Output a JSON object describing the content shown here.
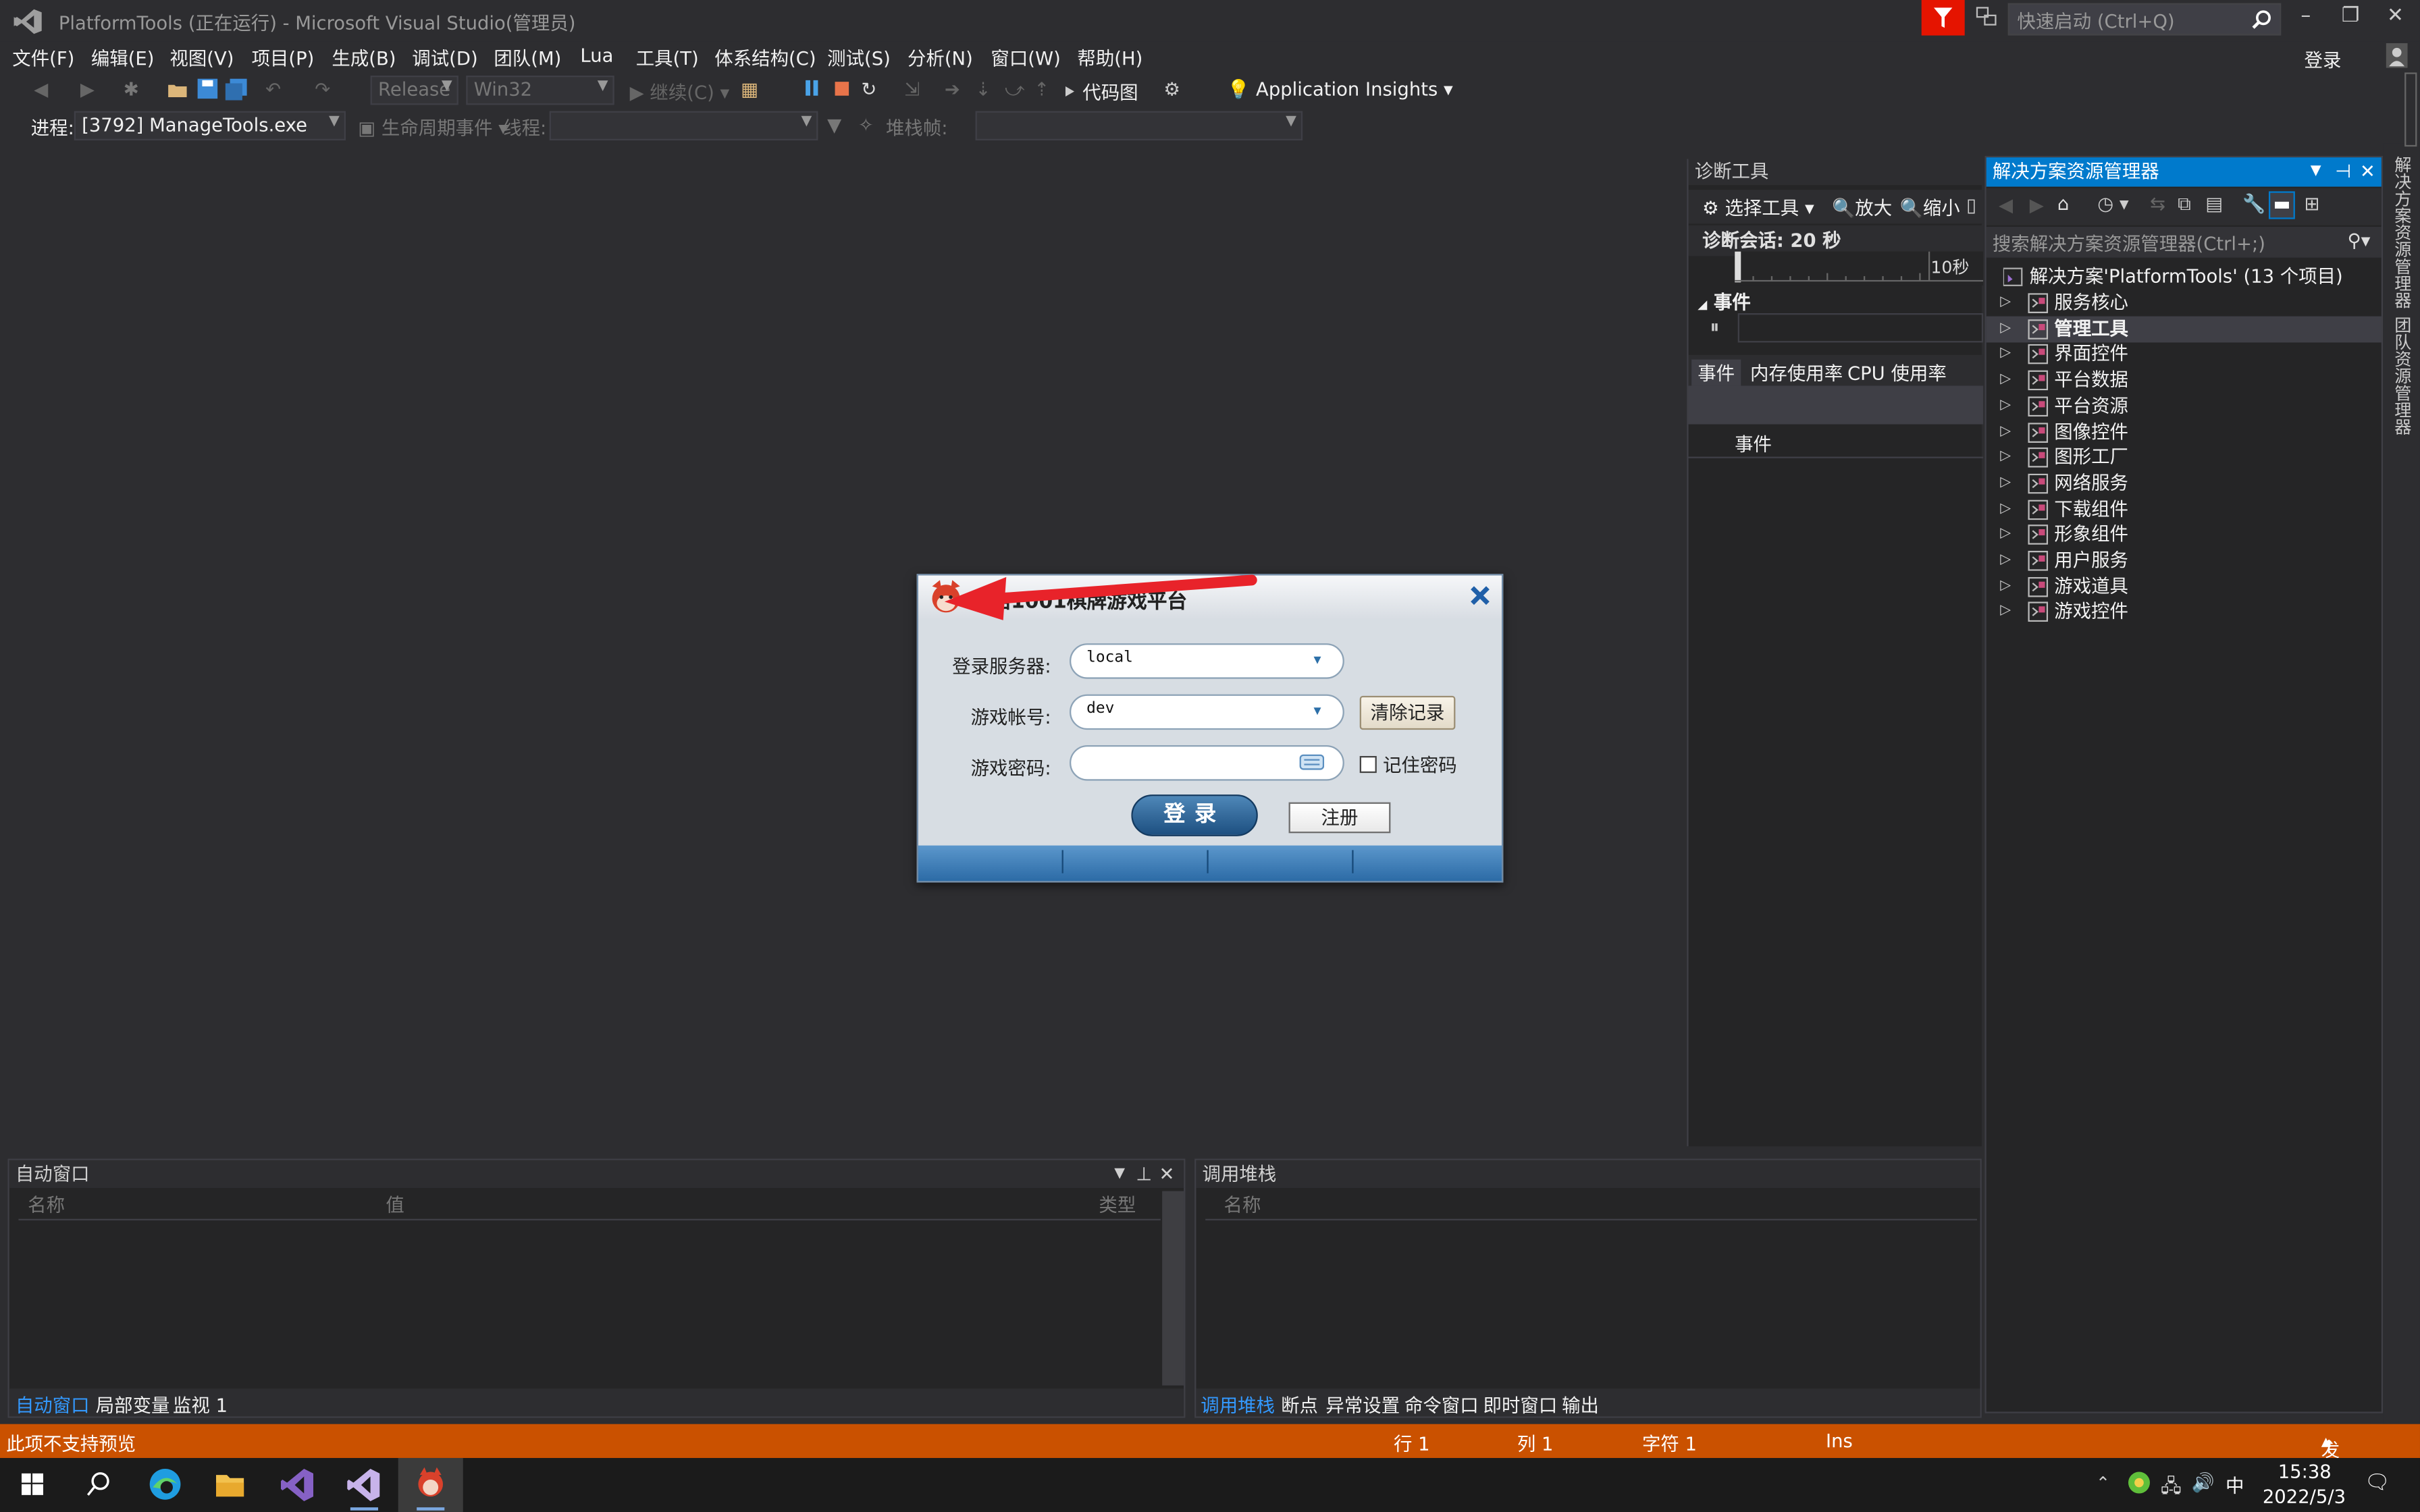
{
  "window": {
    "title": "PlatformTools (正在运行) - Microsoft Visual Studio(管理员)",
    "quick_launch_placeholder": "快速启动 (Ctrl+Q)",
    "sign_in": "登录"
  },
  "menu": [
    "文件(F)",
    "编辑(E)",
    "视图(V)",
    "项目(P)",
    "生成(B)",
    "调试(D)",
    "团队(M)",
    "Lua",
    "工具(T)",
    "体系结构(C)",
    "测试(S)",
    "分析(N)",
    "窗口(W)",
    "帮助(H)"
  ],
  "toolbar": {
    "config": "Release",
    "platform": "Win32",
    "continue": "继续(C)",
    "code_map": "代码图",
    "app_insights": "Application Insights"
  },
  "debug_toolbar": {
    "process_label": "进程:",
    "process_value": "[3792] ManageTools.exe",
    "lifecycle": "生命周期事件",
    "thread_label": "线程:",
    "stackframe_label": "堆栈帧:"
  },
  "diagnostics": {
    "title": "诊断工具",
    "select_tool": "选择工具",
    "zoom_in": "放大",
    "zoom_out": "缩小",
    "session": "诊断会话: 20 秒",
    "ruler_label": "10秒",
    "events_section": "事件",
    "tabs": [
      "事件",
      "内存使用率",
      "CPU 使用率"
    ],
    "events_column": "事件"
  },
  "solution_explorer": {
    "title": "解决方案资源管理器",
    "search_placeholder": "搜索解决方案资源管理器(Ctrl+;)",
    "solution": "解决方案'PlatformTools' (13 个项目)",
    "projects": [
      "服务核心",
      "管理工具",
      "界面控件",
      "平台数据",
      "平台资源",
      "图像控件",
      "图形工厂",
      "网络服务",
      "下载组件",
      "形象组件",
      "用户服务",
      "游戏道具",
      "游戏控件"
    ],
    "selected": "管理工具"
  },
  "side_tabs": [
    "解决方案资源管理器",
    "团队资源管理器"
  ],
  "auto_window": {
    "title": "自动窗口",
    "columns": [
      "名称",
      "值",
      "类型"
    ],
    "tabs": [
      "自动窗口",
      "局部变量",
      "监视 1"
    ]
  },
  "call_stack": {
    "title": "调用堆栈",
    "columns": [
      "名称"
    ],
    "tabs": [
      "调用堆栈",
      "断点",
      "异常设置",
      "命令窗口",
      "即时窗口",
      "输出"
    ]
  },
  "status_bar": {
    "message": "此项不支持预览",
    "line": "行 1",
    "col": "列 1",
    "char": "字符 1",
    "ins": "Ins",
    "publish": "发布"
  },
  "taskbar": {
    "time": "15:38",
    "date": "2022/5/3",
    "ime": "中"
  },
  "login_dialog": {
    "title": "网络1001棋牌游戏平台",
    "server_label": "登录服务器:",
    "server_value": "local",
    "account_label": "游戏帐号:",
    "account_value": "dev",
    "password_label": "游戏密码:",
    "password_value": "",
    "clear_button": "清除记录",
    "remember": "记住密码",
    "login_button": "登录",
    "register_button": "注册"
  },
  "colors": {
    "accent": "#007acc",
    "status_bar": "#ca5100",
    "arrow": "#e8232a"
  }
}
